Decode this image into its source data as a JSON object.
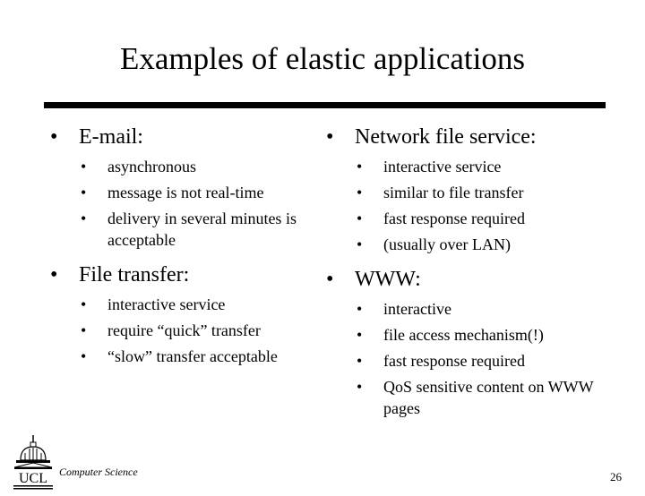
{
  "slide": {
    "title": "Examples of elastic applications",
    "page_number": "26",
    "footer_dept": "Computer Science",
    "logo_text": "UCL",
    "bullet_glyph": "•"
  },
  "left_column": [
    {
      "heading": "E-mail:",
      "items": [
        "asynchronous",
        "message is not real-time",
        "delivery in several minutes is acceptable"
      ]
    },
    {
      "heading": "File transfer:",
      "items": [
        "interactive service",
        "require “quick” transfer",
        "“slow” transfer acceptable"
      ]
    }
  ],
  "right_column": [
    {
      "heading": "Network file service:",
      "items": [
        "interactive service",
        "similar to file transfer",
        "fast response required",
        "(usually over LAN)"
      ]
    },
    {
      "heading": "WWW:",
      "items": [
        "interactive",
        "file access mechanism(!)",
        "fast response required",
        "QoS sensitive content on WWW pages"
      ]
    }
  ]
}
